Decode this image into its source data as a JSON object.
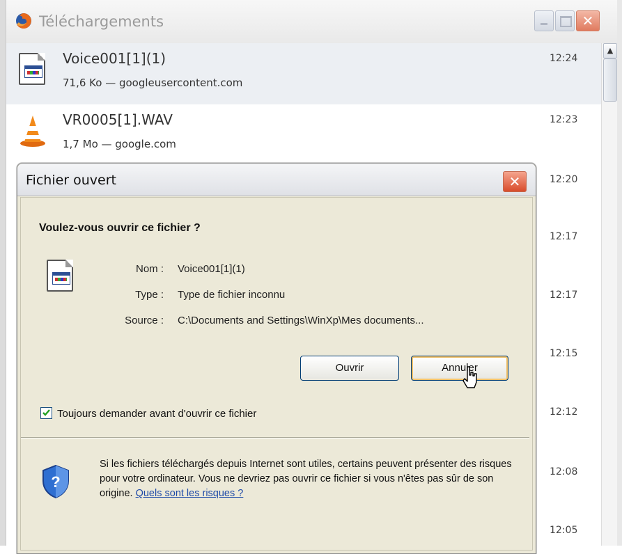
{
  "window": {
    "title": "Téléchargements",
    "icons": [
      "firefox-icon",
      "minimize-icon",
      "maximize-icon",
      "close-icon"
    ]
  },
  "downloads": [
    {
      "name": "Voice001[1](1)",
      "meta": "71,6 Ko — googleusercontent.com",
      "time": "12:24",
      "icon": "document-icon"
    },
    {
      "name": "VR0005[1].WAV",
      "meta": "1,7 Mo — google.com",
      "time": "12:23",
      "icon": "vlc-cone-icon"
    },
    {
      "time": "12:20"
    },
    {
      "time": "12:17"
    },
    {
      "time": "12:17"
    },
    {
      "time": "12:15"
    },
    {
      "time": "12:12"
    },
    {
      "time": "12:08"
    },
    {
      "time": "12:05"
    }
  ],
  "dialog": {
    "title": "Fichier ouvert",
    "question": "Voulez-vous ouvrir ce fichier ?",
    "name_label": "Nom :",
    "name_value": "Voice001[1](1)",
    "type_label": "Type :",
    "type_value": "Type de fichier inconnu",
    "source_label": "Source :",
    "source_value": "C:\\Documents and Settings\\WinXp\\Mes documents...",
    "open_button": "Ouvrir",
    "cancel_button": "Annuler",
    "always_ask_label": "Toujours demander avant d'ouvrir ce fichier",
    "always_ask_checked": true,
    "warning_text": "Si les fichiers téléchargés depuis Internet sont utiles, certains peuvent présenter des risques pour votre ordinateur. Vous ne devriez pas ouvrir ce fichier si vous n'êtes pas sûr de son origine.",
    "risks_link": "Quels sont les risques ?"
  },
  "colors": {
    "dialog_bg": "#ece9d8",
    "link": "#1e4aa8",
    "close_red": "#d84b2b",
    "selected_row": "#eceff3"
  }
}
